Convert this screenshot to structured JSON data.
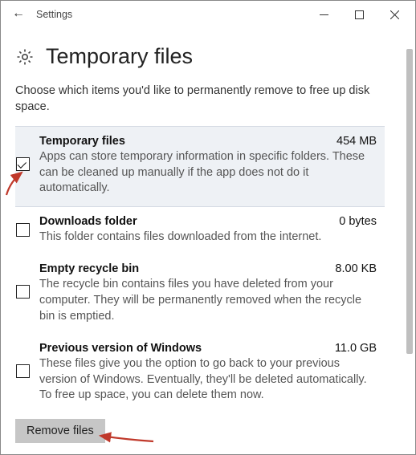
{
  "window": {
    "title": "Settings"
  },
  "page": {
    "title": "Temporary files",
    "intro": "Choose which items you'd like to permanently remove to free up disk space."
  },
  "items": [
    {
      "name": "Temporary files",
      "size": "454 MB",
      "desc": "Apps can store temporary information in specific folders. These can be cleaned up manually if the app does not do it automatically.",
      "checked": true
    },
    {
      "name": "Downloads folder",
      "size": "0 bytes",
      "desc": "This folder contains files downloaded from the internet.",
      "checked": false
    },
    {
      "name": "Empty recycle bin",
      "size": "8.00 KB",
      "desc": "The recycle bin contains files you have deleted from your computer. They will be permanently removed when the recycle bin is emptied.",
      "checked": false
    },
    {
      "name": "Previous version of Windows",
      "size": "11.0 GB",
      "desc": "These files give you the option to go back to your previous version of Windows. Eventually, they'll be deleted automatically. To free up space, you can delete them now.",
      "checked": false
    }
  ],
  "actions": {
    "remove": "Remove files"
  },
  "colors": {
    "arrow": "#c0392b"
  }
}
